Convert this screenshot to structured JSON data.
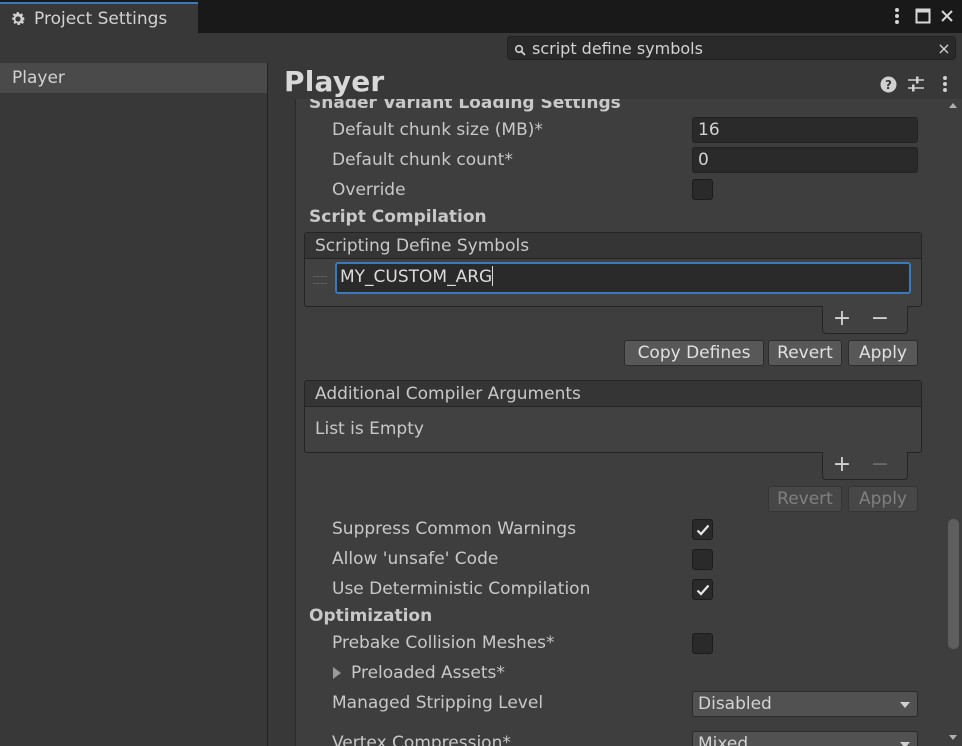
{
  "window": {
    "tab_title": "Project Settings",
    "icons": {
      "tab": "gear-icon",
      "menu": "kebab-menu-icon",
      "maximize": "maximize-icon",
      "close": "close-icon"
    }
  },
  "search": {
    "value": "script define symbols",
    "icon": "search-icon",
    "clear": "×"
  },
  "sidebar": {
    "items": [
      {
        "label": "Player",
        "selected": true
      }
    ]
  },
  "header": {
    "title": "Player",
    "icons": [
      "help-icon",
      "preset-sliders-icon",
      "more-options-icon"
    ]
  },
  "shader_variant": {
    "section_title": "Shader Variant Loading Settings",
    "chunk_size_label": "Default chunk size (MB)*",
    "chunk_size_value": "16",
    "chunk_count_label": "Default chunk count*",
    "chunk_count_value": "0",
    "override_label": "Override",
    "override_checked": false
  },
  "script_compilation": {
    "section_title": "Script Compilation",
    "define_symbols": {
      "header": "Scripting Define Symbols",
      "items": [
        "MY_CUSTOM_ARG"
      ],
      "add": "+",
      "remove": "−",
      "buttons": {
        "copy": "Copy Defines",
        "revert": "Revert",
        "apply": "Apply"
      }
    },
    "compiler_args": {
      "header": "Additional Compiler Arguments",
      "empty_text": "List is Empty",
      "add": "+",
      "remove": "−",
      "buttons": {
        "revert": "Revert",
        "apply": "Apply"
      }
    },
    "suppress_warnings_label": "Suppress Common Warnings",
    "suppress_warnings_checked": true,
    "allow_unsafe_label": "Allow 'unsafe' Code",
    "allow_unsafe_checked": false,
    "deterministic_label": "Use Deterministic Compilation",
    "deterministic_checked": true
  },
  "optimization": {
    "section_title": "Optimization",
    "prebake_label": "Prebake Collision Meshes*",
    "prebake_checked": false,
    "preloaded_assets_label": "Preloaded Assets*",
    "stripping_label": "Managed Stripping Level",
    "stripping_value": "Disabled",
    "vertex_compression_label": "Vertex Compression*",
    "vertex_compression_value": "Mixed..."
  },
  "colors": {
    "accent": "#3a79bb",
    "background": "#383838",
    "panel": "#3e3e3e"
  }
}
